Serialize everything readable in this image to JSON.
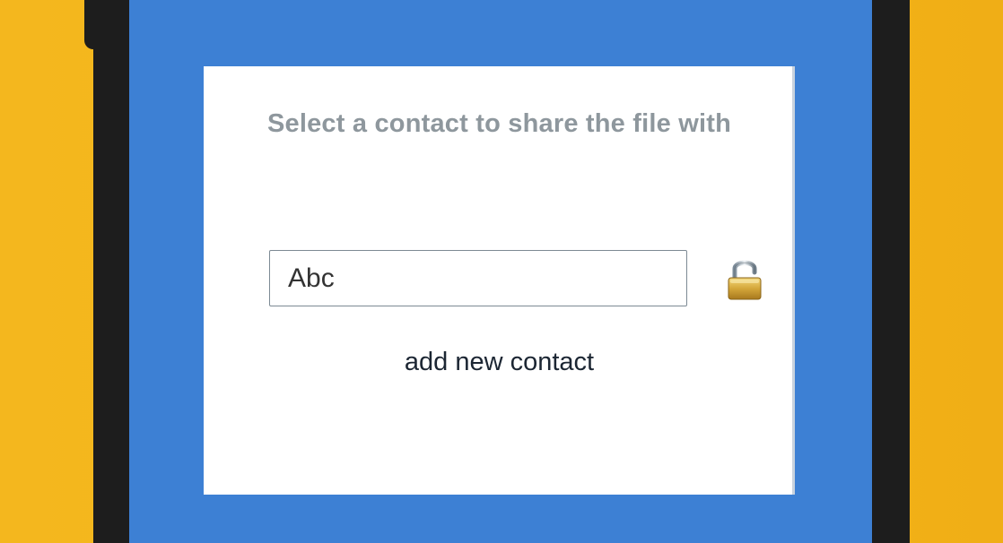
{
  "dialog": {
    "title": "Select a contact to share the file with",
    "contact_input": {
      "value": "Abc"
    },
    "lock_icon": "open-padlock-icon",
    "add_contact_label": "add new contact"
  },
  "colors": {
    "background": "#f4b71e",
    "device_frame": "#1d1d1d",
    "screen": "#3d80d4",
    "dialog": "#ffffff",
    "title_text": "#8e979d",
    "link_text": "#1c2633"
  }
}
